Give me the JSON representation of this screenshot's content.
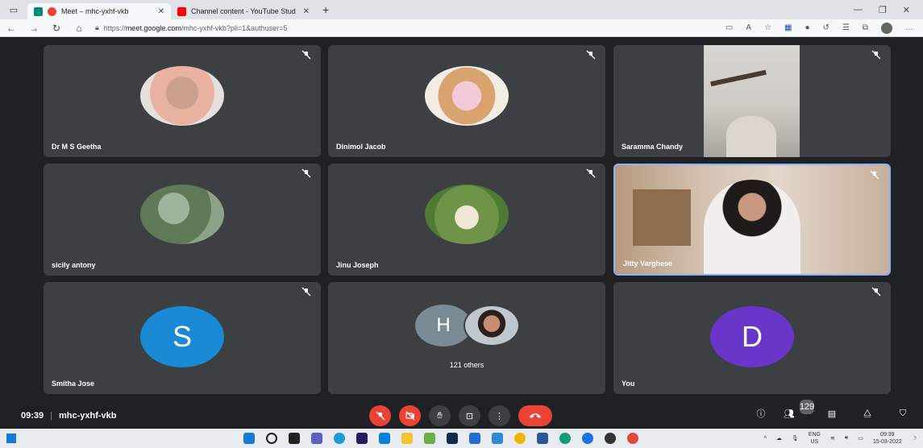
{
  "browser": {
    "tabs": [
      {
        "title": "Meet – mhc-yxhf-vkb",
        "active": true,
        "favicon_color": "#ea4335"
      },
      {
        "title": "Channel content - YouTube Stud",
        "active": false,
        "favicon_color": "#ff0000"
      }
    ],
    "url_prefix": "https://",
    "url_host": "meet.google.com",
    "url_path": "/mhc-yxhf-vkb?pli=1&authuser=5"
  },
  "participants": [
    {
      "name": "Dr M S Geetha",
      "kind": "photo",
      "color": "#e9b2a0"
    },
    {
      "name": "Dinimol Jacob",
      "kind": "photo",
      "color": "#efc9b8"
    },
    {
      "name": "Saramma Chandy",
      "kind": "video",
      "color": "#c9c4bd"
    },
    {
      "name": "sicily antony",
      "kind": "photo",
      "color": "#6f8a66"
    },
    {
      "name": "Jinu Joseph",
      "kind": "photo",
      "color": "#7aa055"
    },
    {
      "name": "Jitty Varghese",
      "kind": "video",
      "color": "#c8b8aa"
    },
    {
      "name": "Smitha Jose",
      "kind": "letter",
      "letter": "S",
      "color": "#1a8ad4"
    },
    {
      "name": "121 others",
      "kind": "group",
      "letter": "H",
      "color": "#7b8b95"
    },
    {
      "name": "You",
      "kind": "letter",
      "letter": "D",
      "color": "#6a35c9"
    }
  ],
  "meeting": {
    "time": "09:39",
    "code": "mhc-yxhf-vkb",
    "participant_count": "129"
  },
  "taskbar": {
    "lang_top": "ENG",
    "lang_bottom": "US",
    "clock_time": "09:39",
    "clock_date": "15-03-2022"
  },
  "colors": {
    "accent_red": "#ea4335",
    "tile_bg": "#3c4043",
    "stage_bg": "#202124"
  }
}
